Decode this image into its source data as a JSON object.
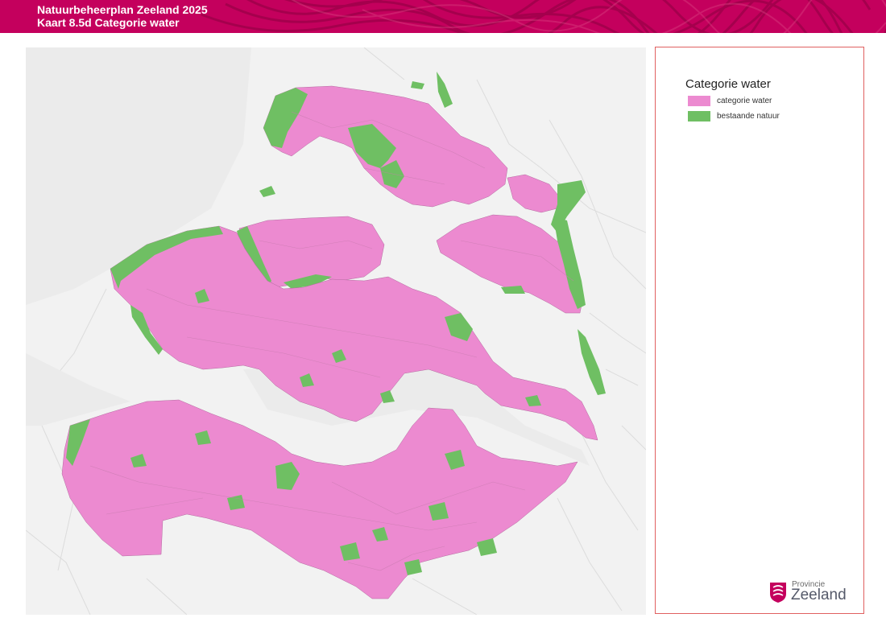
{
  "header": {
    "line1": "Natuurbeheerplan Zeeland 2025",
    "line2": "Kaart 8.5d Categorie water",
    "background_color": "#c4005d"
  },
  "legend": {
    "title": "Categorie water",
    "items": [
      {
        "label": "categorie water",
        "color": "#ec8ad0"
      },
      {
        "label": "bestaande natuur",
        "color": "#6fbf63"
      }
    ]
  },
  "logo": {
    "small_text": "Provincie",
    "big_text": "Zeeland",
    "icon": "zeeland-lion-shield-icon",
    "color": "#c4005d"
  },
  "map": {
    "basemap_color": "#f2f2f2",
    "water_color": "#ec8ad0",
    "nature_color": "#6fbf63"
  }
}
